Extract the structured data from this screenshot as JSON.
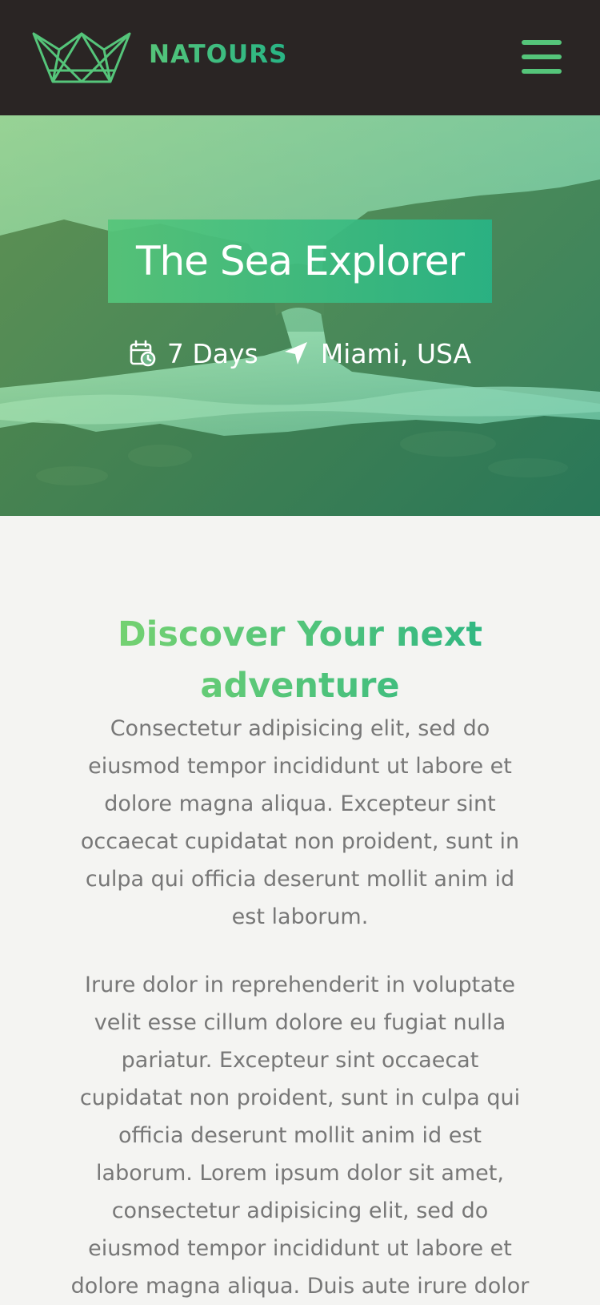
{
  "header": {
    "brand": "NATOURS",
    "logo_icon": "crown-icon",
    "menu_icon": "hamburger-menu-icon"
  },
  "hero": {
    "title": "The Sea Explorer",
    "duration": "7 Days",
    "duration_icon": "calendar-clock-icon",
    "location": "Miami, USA",
    "location_icon": "location-arrow-icon"
  },
  "content": {
    "heading": "Discover Your next adventure",
    "paragraphs": [
      "Consectetur adipisicing elit, sed do eiusmod tempor incididunt ut labore et dolore magna aliqua. Excepteur sint occaecat cupidatat non proident, sunt in culpa qui officia deserunt mollit anim id est laborum.",
      "Irure dolor in reprehenderit in voluptate velit esse cillum dolore eu fugiat nulla pariatur. Excepteur sint occaecat cupidatat non proident, sunt in culpa qui officia deserunt mollit anim id est laborum. Lorem ipsum dolor sit amet, consectetur adipisicing elit, sed do eiusmod tempor incididunt ut labore et dolore magna aliqua. Duis aute irure dolor"
    ]
  },
  "colors": {
    "header_bg": "#2a2524",
    "primary_green": "#55c57a",
    "secondary_green": "#28b485",
    "page_bg": "#f4f4f2",
    "body_text": "#777777"
  }
}
